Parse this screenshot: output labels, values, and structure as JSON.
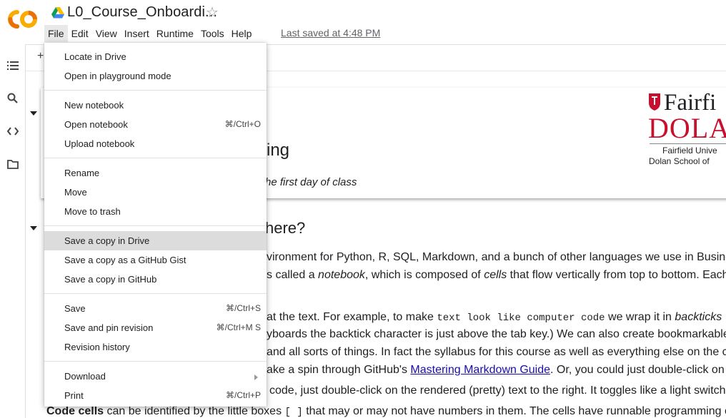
{
  "header": {
    "logo_text": "CO",
    "title": "L0_Course_Onboardi...",
    "last_saved": "Last saved at 4:48 PM",
    "menus": [
      "File",
      "Edit",
      "View",
      "Insert",
      "Runtime",
      "Tools",
      "Help"
    ]
  },
  "colors": {
    "logo_orange": "#F9AB00",
    "logo_dark_orange": "#E8710A",
    "fairfield_red": "#C8102E",
    "menu_highlight": "#DCDCDC"
  },
  "sidebar": {
    "icons": [
      "toc-icon",
      "search-icon",
      "code-snippets-icon",
      "folder-icon"
    ]
  },
  "toolbar": {
    "add_label": "+"
  },
  "file_menu": {
    "groups": [
      [
        {
          "label": "Locate in Drive",
          "shortcut": ""
        },
        {
          "label": "Open in playground mode",
          "shortcut": ""
        }
      ],
      [
        {
          "label": "New notebook",
          "shortcut": ""
        },
        {
          "label": "Open notebook",
          "shortcut": "⌘/Ctrl+O"
        },
        {
          "label": "Upload notebook",
          "shortcut": ""
        }
      ],
      [
        {
          "label": "Rename",
          "shortcut": ""
        },
        {
          "label": "Move",
          "shortcut": ""
        },
        {
          "label": "Move to trash",
          "shortcut": ""
        }
      ],
      [
        {
          "label": "Save a copy in Drive",
          "shortcut": ""
        },
        {
          "label": "Save a copy as a GitHub Gist",
          "shortcut": ""
        },
        {
          "label": "Save a copy in GitHub",
          "shortcut": ""
        }
      ],
      [
        {
          "label": "Save",
          "shortcut": "⌘/Ctrl+S"
        },
        {
          "label": "Save and pin revision",
          "shortcut": "⌘/Ctrl+M S"
        },
        {
          "label": "Revision history",
          "shortcut": ""
        }
      ],
      [
        {
          "label": "Download",
          "shortcut": ""
        },
        {
          "label": "Print",
          "shortcut": "⌘/Ctrl+P"
        }
      ]
    ]
  },
  "notebook": {
    "heading_fragment": "ing",
    "subtitle_fragment": "he first day of class",
    "section_heading_fragment": "here?",
    "logo": {
      "line1": "Fairfi",
      "line2": "DOLA",
      "line3": "Fairfield Unive",
      "line4": "Dolan School of"
    },
    "paragraphs": {
      "p1_a": "vironment for Python, R, SQL, Markdown, and a bunch of other languages we use in Busines",
      "p2_a": "s called a ",
      "p2_b": "notebook",
      "p2_c": ", which is composed of ",
      "p2_d": "cells",
      "p2_e": " that flow vertically from top to bottom. Each",
      "p3_a": "at the text. For example, to make ",
      "p3_code": "text look like computer code",
      "p3_b": " we wrap it in ",
      "p3_c": "backticks",
      "p4_a": "yboards the backtick character is just above the tab key.) We can also create bookmarkable",
      "p5_a": "and all sorts of things. In fact the syllabus for this course as well as everything else on the c",
      "p6_a": "ake a spin through GitHub's ",
      "p6_link": "Mastering Markdown Guide",
      "p6_b": ". Or, you could just double-click on a",
      "p7_a": "code, just double-click on the rendered (pretty) text to the right. It toggles like a light switch",
      "p8_bold": "Code cells",
      "p8_a": " can be identified by the little boxes ",
      "p8_code": "[ ]",
      "p8_b": " that may or may not have numbers in them. The cells have runnable programming co"
    }
  }
}
